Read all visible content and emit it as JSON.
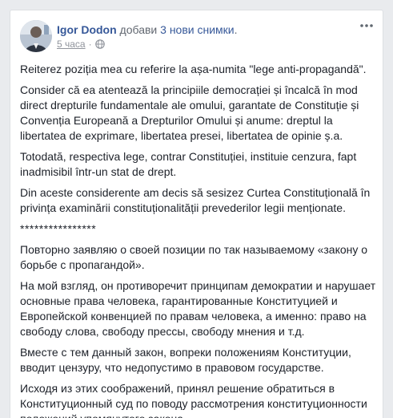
{
  "post": {
    "author": {
      "name": "Igor Dodon",
      "action": "добави",
      "photos_link": "3 нови снимки",
      "trailing": "."
    },
    "meta": {
      "time": "5 часа",
      "dot": "·",
      "privacy_icon": "globe-icon"
    },
    "menu_icon": "ellipsis-icon",
    "paragraphs": [
      "Reiterez poziția mea cu referire la așa-numita \"lege anti-propagandă\".",
      "Consider că ea atentează la principiile democrației și încalcă în mod direct drepturile fundamentale ale omului, garantate de Constituție și Convenția Europeană a Drepturilor Omului și anume: dreptul la libertatea de exprimare, libertatea presei, libertatea de opinie ș.a.",
      "Totodată, respectiva lege, contrar Constituției, instituie cenzura, fapt inadmisibil într-un stat de drept.",
      "Din aceste considerente am decis să sesizez Curtea Constituțională în privința examinării constituționalității prevederilor legii menționate.",
      "****************",
      "Повторно заявляю о своей позиции по так называемому «закону о борьбе с пропагандой».",
      "На мой взгляд, он противоречит принципам демократии и нарушает основные права человека, гарантированные Конституцией и Европейской конвенцией по правам человека, а именно: право на свободу слова, свободу прессы, свободу мнения и т.д.",
      "Вместе с тем данный закон, вопреки положениям Конституции, вводит цензуру, что недопустимо в правовом государстве.",
      "Исходя из этих соображений, принял решение обратиться в Конституционный суд по поводу рассмотрения конституционности положений упомянутого закона."
    ]
  },
  "colors": {
    "link": "#365899",
    "text": "#1d2129",
    "muted": "#90949c",
    "background": "#e9ebee"
  }
}
